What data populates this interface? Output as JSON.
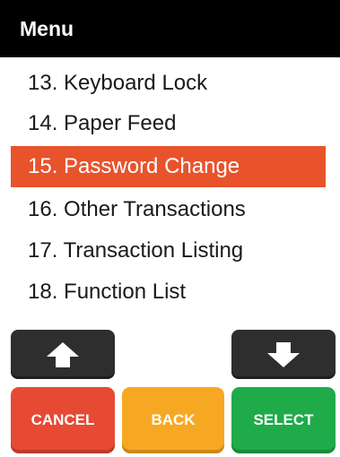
{
  "header": {
    "title": "Menu"
  },
  "menu": {
    "items": [
      {
        "label": "13. Keyboard Lock"
      },
      {
        "label": "14. Paper Feed"
      },
      {
        "label": "15. Password Change"
      },
      {
        "label": "16. Other Transactions"
      },
      {
        "label": "17. Transaction Listing"
      },
      {
        "label": "18. Function List"
      }
    ],
    "selected_label": "15. Password Change"
  },
  "navigation": {
    "up_icon": "arrow-up-icon",
    "down_icon": "arrow-down-icon"
  },
  "actions": {
    "cancel_label": "CANCEL",
    "back_label": "BACK",
    "select_label": "SELECT"
  },
  "colors": {
    "header_bg": "#000000",
    "selected_bg": "#e8532c",
    "arrow_bg": "#2e2e2e",
    "cancel": "#e64a33",
    "back": "#f7a823",
    "select": "#1fab4a"
  }
}
